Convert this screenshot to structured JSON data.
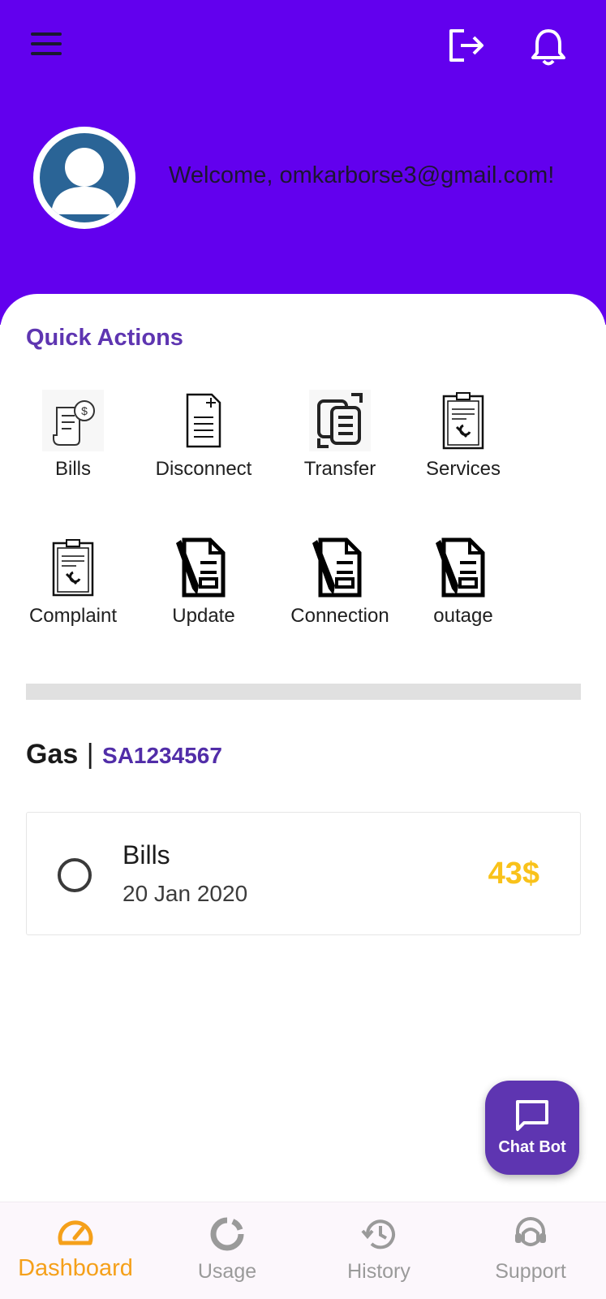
{
  "header": {
    "menu_icon": "hamburger-menu-icon",
    "logout_icon": "logout-icon",
    "notification_icon": "bell-icon",
    "welcome_text": "Welcome, omkarborse3@gmail.com!",
    "bg_color": "#6200EE"
  },
  "quick_actions": {
    "title": "Quick Actions",
    "items": [
      {
        "label": "Bills",
        "icon": "bill-receipt-icon"
      },
      {
        "label": "Disconnect",
        "icon": "document-icon"
      },
      {
        "label": "Transfer",
        "icon": "transfer-icon"
      },
      {
        "label": "Services",
        "icon": "clipboard-wrench-icon"
      },
      {
        "label": "Complaint",
        "icon": "clipboard-wrench-icon"
      },
      {
        "label": "Update",
        "icon": "document-pen-icon"
      },
      {
        "label": "Connection",
        "icon": "document-pen-icon"
      },
      {
        "label": "outage",
        "icon": "document-pen-icon"
      }
    ]
  },
  "account": {
    "type": "Gas",
    "separator": "|",
    "number": "SA1234567"
  },
  "bill": {
    "name": "Bills",
    "date": "20 Jan 2020",
    "amount": "43$",
    "amount_color": "#F9C21A"
  },
  "chatbot": {
    "label": "Chat Bot",
    "icon": "chat-bubble-icon",
    "color": "#5E35B1"
  },
  "bottom_nav": {
    "items": [
      {
        "label": "Dashboard",
        "icon": "speedometer-icon",
        "active": true
      },
      {
        "label": "Usage",
        "icon": "donut-chart-icon",
        "active": false
      },
      {
        "label": "History",
        "icon": "history-icon",
        "active": false
      },
      {
        "label": "Support",
        "icon": "support-agent-icon",
        "active": false
      }
    ],
    "active_color": "#F5A01A"
  }
}
